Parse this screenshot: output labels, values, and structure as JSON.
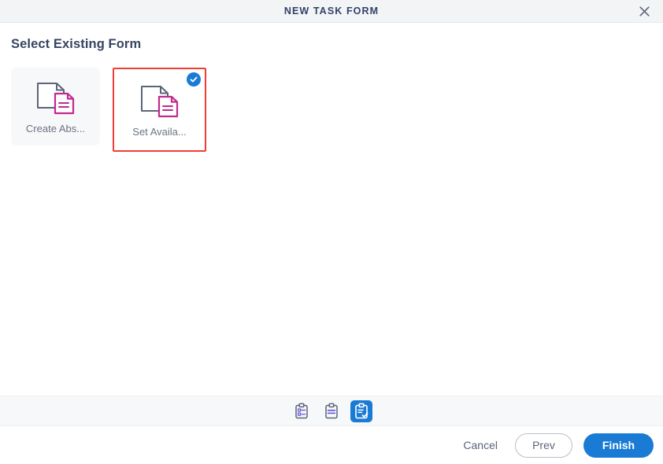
{
  "titlebar": {
    "title": "NEW TASK FORM",
    "close_icon": "close-icon"
  },
  "body": {
    "heading": "Select Existing Form",
    "cards": [
      {
        "label": "Create Abs...",
        "icon": "document-pair-icon",
        "selected": false
      },
      {
        "label": "Set Availa...",
        "icon": "document-pair-icon",
        "selected": true,
        "badge_icon": "check-circle-icon"
      }
    ]
  },
  "stepbar": {
    "steps": [
      {
        "icon": "clipboard-checklist-icon",
        "active": false
      },
      {
        "icon": "clipboard-lines-icon",
        "active": false
      },
      {
        "icon": "clipboard-check-icon",
        "active": true
      }
    ]
  },
  "footer": {
    "cancel_label": "Cancel",
    "prev_label": "Prev",
    "finish_label": "Finish"
  },
  "colors": {
    "accent_blue": "#1a7bd4",
    "selected_border_red": "#ef3e36",
    "doc_gray": "#5b6478",
    "doc_magenta": "#c2298f",
    "step_purple": "#6f5fd6",
    "header_bg": "#f3f4f6",
    "card_bg": "#f7f8fa"
  }
}
